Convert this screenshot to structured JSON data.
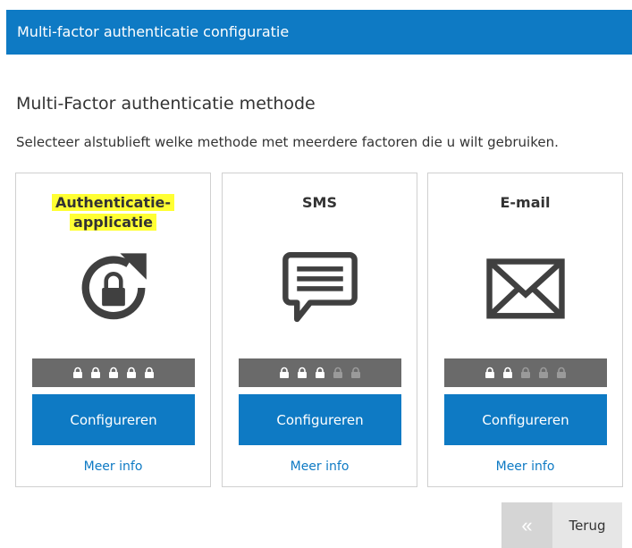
{
  "header": {
    "title": "Multi-factor authenticatie configuratie"
  },
  "section": {
    "title": "Multi-Factor authenticatie methode",
    "instructions": "Selecteer alstublieft welke methode met meerdere factoren die u wilt gebruiken."
  },
  "methods": [
    {
      "title_line1": "Authenticatie-",
      "title_line2": "applicatie",
      "highlighted": true,
      "icon": "lock-refresh-icon",
      "strength": 5,
      "strength_max": 5,
      "button_label": "Configureren",
      "info_label": "Meer info"
    },
    {
      "title": "SMS",
      "icon": "chat-message-icon",
      "strength": 3,
      "strength_max": 5,
      "button_label": "Configureren",
      "info_label": "Meer info"
    },
    {
      "title": "E-mail",
      "icon": "envelope-icon",
      "strength": 2,
      "strength_max": 5,
      "button_label": "Configureren",
      "info_label": "Meer info"
    }
  ],
  "colors": {
    "brand": "#0e7ac4",
    "highlight": "#ffff33",
    "lock_active": "#ffffff",
    "lock_inactive": "#9a9a9a"
  },
  "back_button": {
    "icon": "double-chevron-left-icon",
    "icon_glyph": "«",
    "label": "Terug"
  }
}
